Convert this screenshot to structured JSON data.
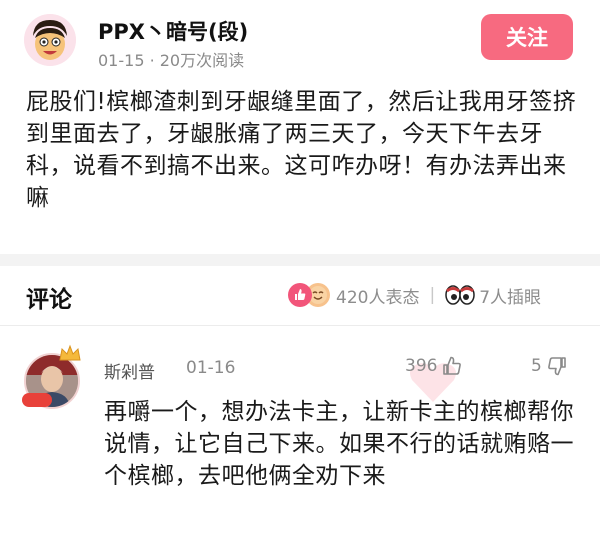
{
  "post": {
    "username": "PPX丶暗号(段)",
    "meta": "01-15 · 20万次阅读",
    "follow_label": "关注",
    "body": "屁股们!槟榔渣刺到牙龈缝里面了，然后让我用牙签挤到里面去了，牙龈胀痛了两三天了，今天下午去牙科，说看不到搞不出来。这可咋办呀！有办法弄出来嘛"
  },
  "comments_section": {
    "title": "评论",
    "reactions_label": "420人表态",
    "separator": "|",
    "stares_label": "7人插眼"
  },
  "comment": {
    "author": "斯剁普",
    "date": "01-16",
    "likes": "396",
    "dislikes": "5",
    "body": "再嚼一个，想办法卡主，让新卡主的槟榔帮你说情，让它自己下来。如果不行的话就贿赂一个槟榔，去吧他俩全劝下来"
  },
  "colors": {
    "accent": "#f76a80",
    "text": "#1a1a1a",
    "muted": "#8a8a8a"
  },
  "icons": [
    "post-avatar-cartoon-icon",
    "like-reaction-icon",
    "smile-reaction-icon",
    "eyes-icon",
    "crown-icon",
    "thumbs-up-icon",
    "thumbs-down-icon"
  ]
}
